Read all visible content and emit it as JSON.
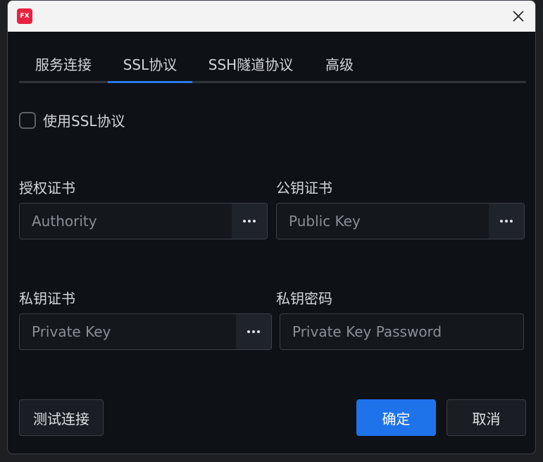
{
  "window": {
    "logo_text": "FX",
    "accent_color": "#1f73ea",
    "logo_color": "#e8223f"
  },
  "tabs": [
    {
      "label": "服务连接",
      "active": false
    },
    {
      "label": "SSL协议",
      "active": true
    },
    {
      "label": "SSH隧道协议",
      "active": false
    },
    {
      "label": "高级",
      "active": false
    }
  ],
  "ssl": {
    "use_ssl_label": "使用SSL协议",
    "use_ssl_checked": false
  },
  "fields": {
    "authority": {
      "label": "授权证书",
      "placeholder": "Authority",
      "value": ""
    },
    "public_key": {
      "label": "公钥证书",
      "placeholder": "Public Key",
      "value": ""
    },
    "private_key": {
      "label": "私钥证书",
      "placeholder": "Private Key",
      "value": ""
    },
    "private_key_password": {
      "label": "私钥密码",
      "placeholder": "Private Key Password",
      "value": ""
    }
  },
  "buttons": {
    "test_connection": "测试连接",
    "ok": "确定",
    "cancel": "取消"
  },
  "icons": {
    "close": "close-icon",
    "browse": "ellipsis-icon"
  }
}
